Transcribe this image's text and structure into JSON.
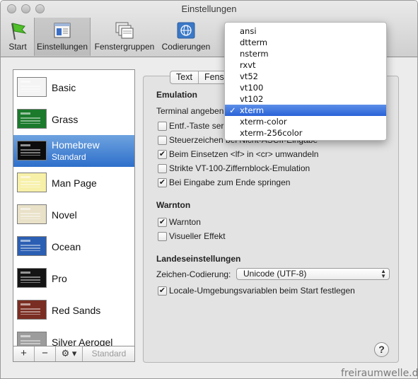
{
  "window": {
    "title": "Einstellungen"
  },
  "toolbar": [
    {
      "label": "Start",
      "icon": "flag-icon"
    },
    {
      "label": "Einstellungen",
      "icon": "settings-window-icon"
    },
    {
      "label": "Fenstergruppen",
      "icon": "window-groups-icon"
    },
    {
      "label": "Codierungen",
      "icon": "globe-icon"
    }
  ],
  "profiles": [
    {
      "name": "Basic",
      "bg": "#f4f4f4",
      "fg": "#3a3a3a"
    },
    {
      "name": "Grass",
      "bg": "#1b7a2c",
      "fg": "#e8f6c0"
    },
    {
      "name": "Homebrew",
      "subtitle": "Standard",
      "bg": "#0c0c0c",
      "fg": "#2ee22e",
      "selected": true
    },
    {
      "name": "Man Page",
      "bg": "#f7f0a8",
      "fg": "#333"
    },
    {
      "name": "Novel",
      "bg": "#e9e1c8",
      "fg": "#4a3a2a"
    },
    {
      "name": "Ocean",
      "bg": "#2b5fb3",
      "fg": "#ffffff"
    },
    {
      "name": "Pro",
      "bg": "#141414",
      "fg": "#d9d9d9"
    },
    {
      "name": "Red Sands",
      "bg": "#7a2d22",
      "fg": "#f1d6a6"
    },
    {
      "name": "Silver Aerogel",
      "bg": "#9c9c9c",
      "fg": "#111"
    }
  ],
  "list_bottom": {
    "add": "+",
    "remove": "−",
    "gear": "⚙ ▾",
    "default": "Standard"
  },
  "tabs": [
    "Text",
    "Fenste"
  ],
  "emulation": {
    "heading": "Emulation",
    "terminal_label": "Terminal angeben",
    "checks": [
      {
        "label": "Entf.-Taste ser",
        "checked": false
      },
      {
        "label": "Steuerzeichen bei Nicht-ASCII-Eingabe",
        "checked": false
      },
      {
        "label": "Beim Einsetzen <lf> in <cr> umwandeln",
        "checked": true
      },
      {
        "label": "Strikte VT-100-Ziffernblock-Emulation",
        "checked": false
      },
      {
        "label": "Bei Eingabe zum Ende springen",
        "checked": true
      }
    ]
  },
  "warnton": {
    "heading": "Warnton",
    "checks": [
      {
        "label": "Warnton",
        "checked": true
      },
      {
        "label": "Visueller Effekt",
        "checked": false
      }
    ]
  },
  "locale": {
    "heading": "Landeseinstellungen",
    "encoding_label": "Zeichen-Codierung:",
    "encoding_value": "Unicode (UTF-8)",
    "checks": [
      {
        "label": "Locale-Umgebungsvariablen beim Start festlegen",
        "checked": true
      }
    ]
  },
  "terminal_menu": {
    "items": [
      "ansi",
      "dtterm",
      "nsterm",
      "rxvt",
      "vt52",
      "vt100",
      "vt102",
      "xterm",
      "xterm-color",
      "xterm-256color"
    ],
    "selected_index": 7,
    "check_glyph": "✓"
  },
  "help": "?",
  "watermark": "freiraumwelle.de",
  "colors": {
    "selection": "#2e6fcb",
    "menu_highlight": "#2a63d8"
  }
}
